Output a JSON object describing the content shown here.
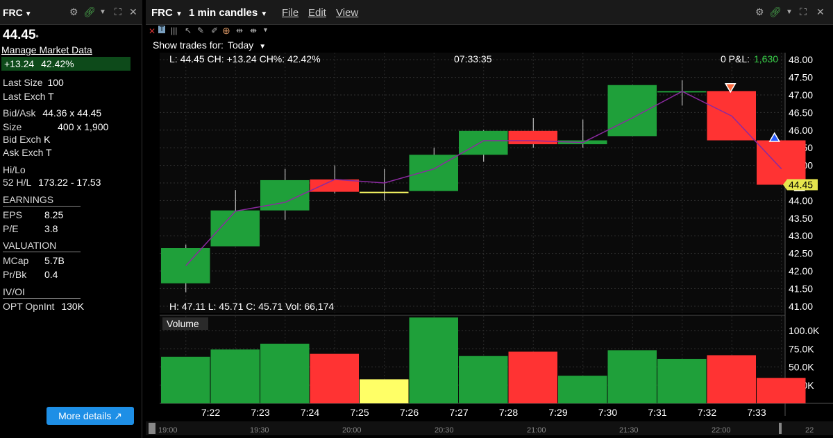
{
  "left_panel": {
    "symbol": "FRC",
    "price": "44.45",
    "manage_market_data": "Manage Market Data",
    "change": "+13.24",
    "change_pct": "42.42%",
    "last_size_label": "Last Size",
    "last_size": "100",
    "last_exch_label": "Last Exch",
    "last_exch": "T",
    "bid_ask_label": "Bid/Ask",
    "bid_ask": "44.36 x 44.45",
    "size_label": "Size",
    "size": "400 x 1,900",
    "bid_exch_label": "Bid Exch",
    "bid_exch": "K",
    "ask_exch_label": "Ask Exch",
    "ask_exch": "T",
    "hilo_label": "Hi/Lo",
    "hl52_label": "52 H/L",
    "hl52": "173.22 - 17.53",
    "earnings_header": "EARNINGS",
    "eps_label": "EPS",
    "eps": "8.25",
    "pe_label": "P/E",
    "pe": "3.8",
    "valuation_header": "VALUATION",
    "mcap_label": "MCap",
    "mcap": "5.7B",
    "prbk_label": "Pr/Bk",
    "prbk": "0.4",
    "ivoi_header": "IV/OI",
    "opt_label": "OPT OpnInt",
    "opt": "130K",
    "more_details": "More details ↗"
  },
  "main_header": {
    "symbol": "FRC",
    "interval": "1 min candles",
    "menus": [
      "File",
      "Edit",
      "View"
    ],
    "show_trades_label": "Show trades for:",
    "show_trades_value": "Today"
  },
  "chart_info": {
    "top_line": "L: 44.45 CH: +13.24 CH%: 42.42%",
    "time": "07:33:35",
    "pnl_prefix": "0 P&L:",
    "pnl_value": "1,630",
    "bottom_line": "H: 47.11  L: 45.71  C: 45.71  Vol: 66,174",
    "volume_label": "Volume",
    "last_price_tag": "44.45"
  },
  "colors": {
    "up": "#1fa03a",
    "down": "#ff3333",
    "flat": "#ffff66",
    "ma": "#8b2aa0",
    "price_tag": "#e6e64d",
    "pnl": "#39d24a"
  },
  "chart_data": {
    "type": "candlestick",
    "time_labels": [
      "7:22",
      "7:23",
      "7:24",
      "7:25",
      "7:26",
      "7:27",
      "7:28",
      "7:29",
      "7:30",
      "7:31",
      "7:32",
      "7:33"
    ],
    "candles": [
      {
        "o": 41.65,
        "h": 42.75,
        "l": 41.4,
        "c": 42.65,
        "dir": "up",
        "ma": 42.15
      },
      {
        "o": 42.7,
        "h": 44.3,
        "l": 42.7,
        "c": 43.72,
        "dir": "up",
        "ma": 43.7
      },
      {
        "o": 43.72,
        "h": 44.9,
        "l": 43.45,
        "c": 44.58,
        "dir": "up",
        "ma": 43.95
      },
      {
        "o": 44.6,
        "h": 45.0,
        "l": 44.2,
        "c": 44.25,
        "dir": "down",
        "ma": 44.6
      },
      {
        "o": 44.25,
        "h": 44.9,
        "l": 44.0,
        "c": 44.25,
        "dir": "flat",
        "ma": 44.5
      },
      {
        "o": 44.27,
        "h": 45.5,
        "l": 44.27,
        "c": 45.3,
        "dir": "up",
        "ma": 44.9
      },
      {
        "o": 45.3,
        "h": 46.0,
        "l": 45.1,
        "c": 45.98,
        "dir": "up",
        "ma": 45.7
      },
      {
        "o": 45.98,
        "h": 46.35,
        "l": 45.5,
        "c": 45.6,
        "dir": "down",
        "ma": 45.7
      },
      {
        "o": 45.6,
        "h": 46.3,
        "l": 45.5,
        "c": 45.71,
        "dir": "up",
        "ma": 45.65
      },
      {
        "o": 45.83,
        "h": 47.28,
        "l": 45.83,
        "c": 47.28,
        "dir": "up",
        "ma": 46.35
      },
      {
        "o": 47.08,
        "h": 47.42,
        "l": 46.7,
        "c": 47.11,
        "dir": "up",
        "ma": 47.1
      },
      {
        "o": 47.11,
        "h": 47.11,
        "l": 45.71,
        "c": 45.71,
        "dir": "down",
        "ma": 46.4
      },
      {
        "o": 45.71,
        "h": 45.71,
        "l": 44.45,
        "c": 44.45,
        "dir": "down",
        "ma": 44.9
      }
    ],
    "volume": [
      64000,
      74000,
      82000,
      68000,
      33000,
      118000,
      65000,
      71000,
      38000,
      73000,
      61000,
      66174,
      35000
    ],
    "trade_markers": [
      {
        "candle": 11,
        "price": 47.2,
        "side": "sell"
      },
      {
        "candle": 12,
        "price": 45.8,
        "side": "buy"
      },
      {
        "candle": 12,
        "price": 44.4,
        "side": "buy"
      }
    ],
    "price_axis": {
      "min": 40.8,
      "max": 48.2,
      "ticks": [
        "48.00",
        "47.50",
        "47.00",
        "46.50",
        "46.00",
        "45.50",
        "45.00",
        "44.50",
        "44.00",
        "43.50",
        "43.00",
        "42.50",
        "42.00",
        "41.50",
        "41.00"
      ]
    },
    "volume_axis": {
      "max": 120000,
      "ticks": [
        "100.0K",
        "75.0K",
        "50.0K",
        "25.0K"
      ]
    },
    "navigator_labels": [
      "19:00",
      "19:30",
      "20:00",
      "20:30",
      "21:00",
      "21:30",
      "22:00",
      "22"
    ],
    "ylabel": "",
    "xlabel": ""
  }
}
